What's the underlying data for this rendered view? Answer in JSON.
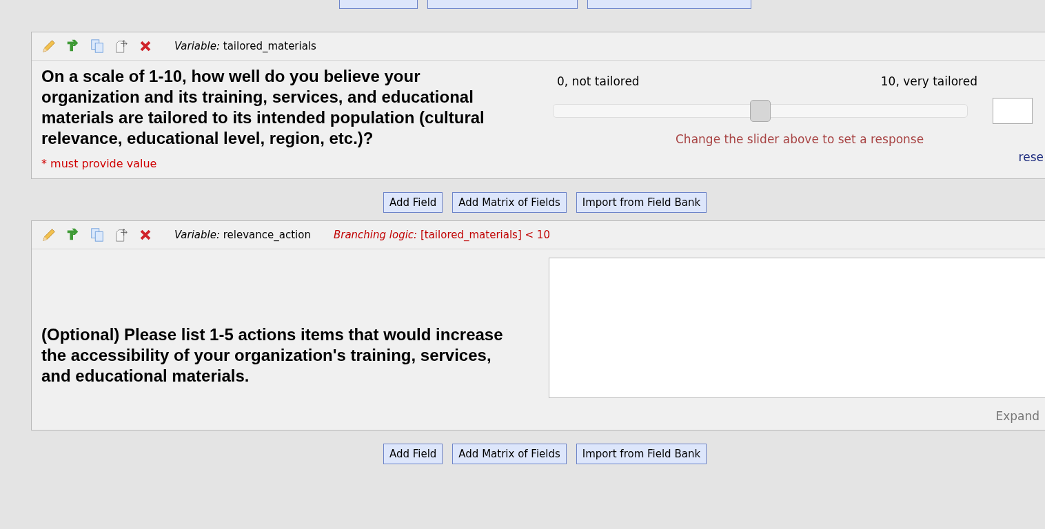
{
  "fields": [
    {
      "kind": "slider",
      "variable_label": "Variable:",
      "variable": "tailored_materials",
      "question": "On a scale of 1-10, how well do you believe your organization and its training, services, and educational materials are tailored to its intended population (cultural relevance, educational level, region, etc.)?",
      "required_note": "* must provide value",
      "left_label": "0, not tailored",
      "right_label": "10, very tailored",
      "level": 0.5,
      "message": "Change the slider above to set a response",
      "reset": "rese"
    },
    {
      "kind": "textarea",
      "variable_label": "Variable:",
      "variable": "relevance_action",
      "branching_label": "Branching logic:",
      "branching": "[tailored_materials] < 10",
      "question": "(Optional) Please list 1-5 actions items that would increase the accessibility of your organization's training, services, and educational materials.",
      "expand": "Expand"
    }
  ],
  "button_rows": [
    [
      "Add Field",
      "Add Matrix of Fields",
      "Import from Field Bank"
    ],
    [
      "Add Field",
      "Add Matrix of Fields",
      "Import from Field Bank"
    ]
  ]
}
